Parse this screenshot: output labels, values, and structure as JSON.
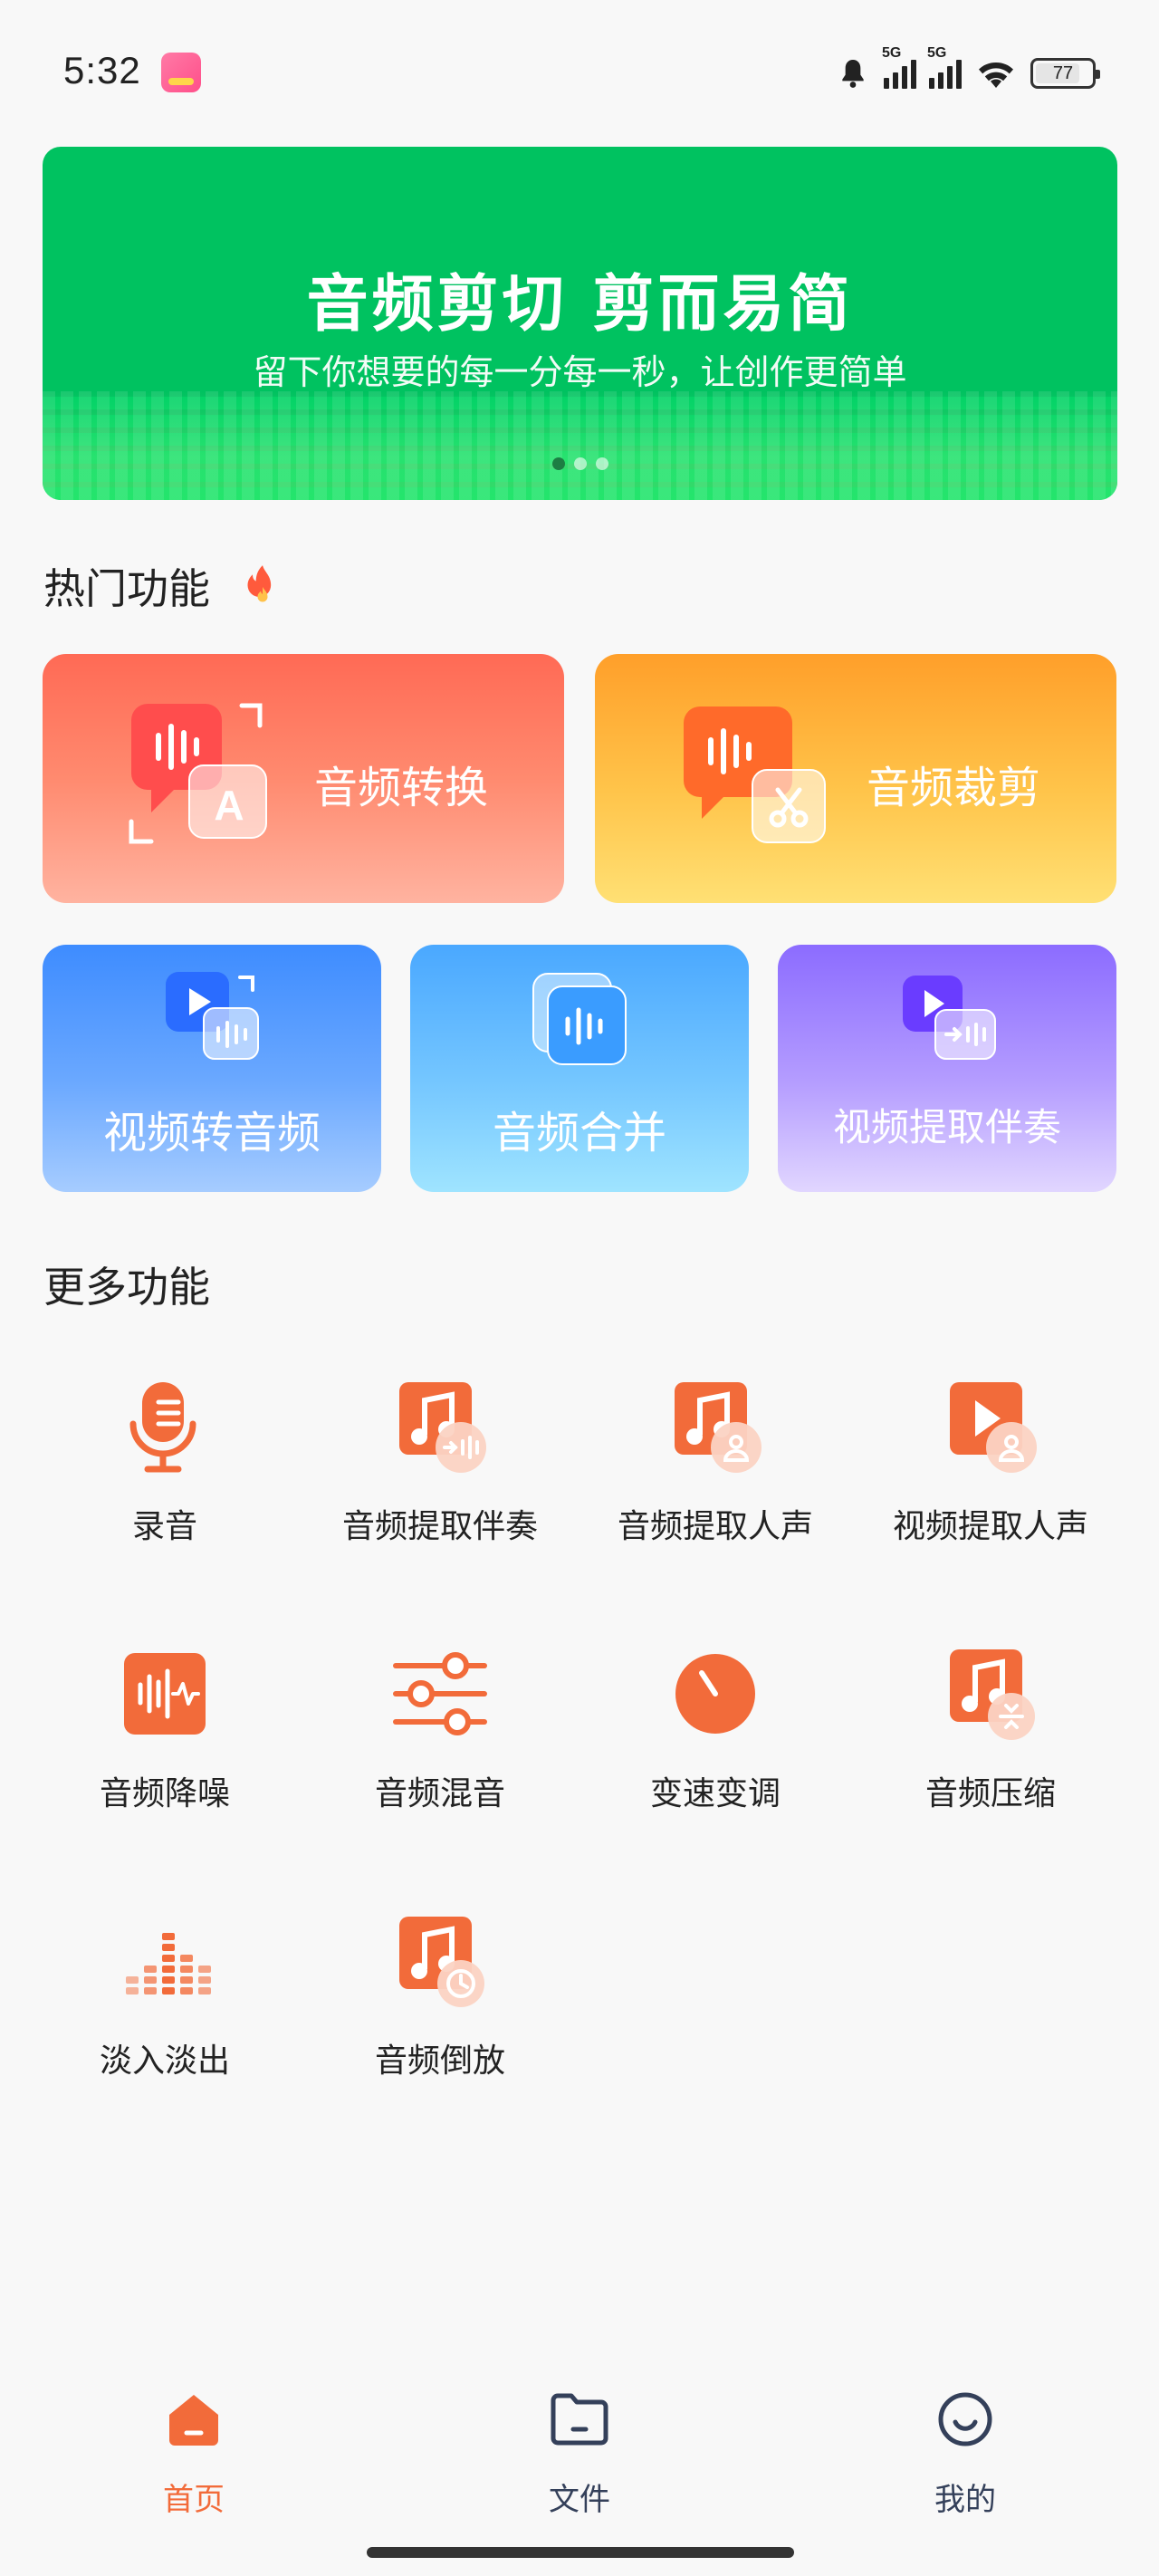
{
  "status_bar": {
    "time": "5:32",
    "signal1": "5G",
    "signal2": "5G",
    "battery": "77"
  },
  "banner": {
    "title": "音频剪切 剪而易简",
    "subtitle": "留下你想要的每一分每一秒，让创作更简单",
    "dots": 3,
    "active_dot": 0
  },
  "hot": {
    "title": "热门功能",
    "cards": [
      {
        "label": "音频转换"
      },
      {
        "label": "音频裁剪"
      },
      {
        "label": "视频转音频"
      },
      {
        "label": "音频合并"
      },
      {
        "label": "视频提取伴奏"
      }
    ]
  },
  "more": {
    "title": "更多功能",
    "items": [
      {
        "label": "录音",
        "icon": "microphone-icon"
      },
      {
        "label": "音频提取伴奏",
        "icon": "music-extract-accompaniment-icon"
      },
      {
        "label": "音频提取人声",
        "icon": "music-extract-vocal-icon"
      },
      {
        "label": "视频提取人声",
        "icon": "video-extract-vocal-icon"
      },
      {
        "label": "音频降噪",
        "icon": "noise-reduction-icon"
      },
      {
        "label": "音频混音",
        "icon": "mixer-sliders-icon"
      },
      {
        "label": "变速变调",
        "icon": "speed-dial-icon"
      },
      {
        "label": "音频压缩",
        "icon": "music-compress-icon"
      },
      {
        "label": "淡入淡出",
        "icon": "fade-bars-icon"
      },
      {
        "label": "音频倒放",
        "icon": "music-reverse-icon"
      }
    ]
  },
  "nav": {
    "items": [
      {
        "label": "首页",
        "icon": "home-icon",
        "active": true
      },
      {
        "label": "文件",
        "icon": "folder-icon",
        "active": false
      },
      {
        "label": "我的",
        "icon": "profile-smile-icon",
        "active": false
      }
    ]
  },
  "colors": {
    "accent": "#f26b3a",
    "banner_green": "#00c260",
    "text": "#222222",
    "nav_inactive": "#34405a"
  }
}
